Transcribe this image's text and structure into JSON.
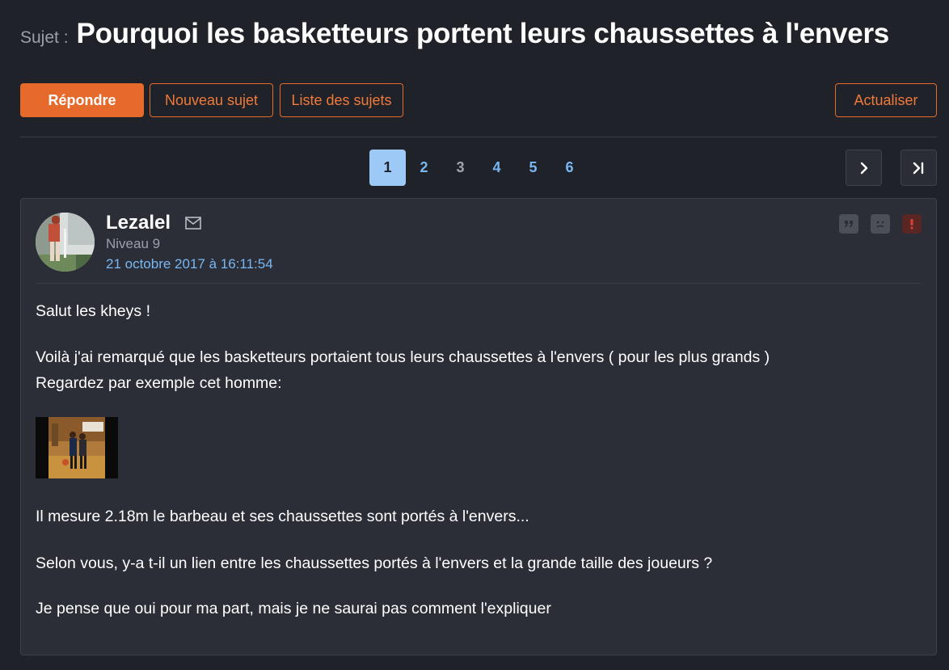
{
  "topic": {
    "prefix": "Sujet :",
    "title": "Pourquoi les basketteurs portent leurs chaussettes à l'envers"
  },
  "actions": {
    "reply": "Répondre",
    "new_topic": "Nouveau sujet",
    "topic_list": "Liste des sujets",
    "refresh": "Actualiser"
  },
  "pagination": {
    "pages": [
      "1",
      "2",
      "3",
      "4",
      "5",
      "6"
    ],
    "current": "1",
    "next_icon": "chevron-right-icon",
    "last_icon": "last-page-icon"
  },
  "post": {
    "author": "Lezalel",
    "level": "Niveau 9",
    "date": "21 octobre 2017 à 16:11:54",
    "paragraphs": [
      "Salut les kheys !",
      "Voilà j'ai remarqué que les basketteurs portaient tous leurs chaussettes à l'envers ( pour les plus grands )",
      "Regardez par exemple cet homme:",
      "Il mesure 2.18m le barbeau et ses chaussettes sont portés à l'envers...",
      "Selon vous, y-a t-il un lien entre les chaussettes portés à l'envers et la grande taille des joueurs ?",
      "Je pense que oui pour ma part, mais je ne saurai pas comment l'expliquer"
    ],
    "icons": [
      "mail-icon",
      "quote-icon",
      "blacklist-icon",
      "report-icon"
    ]
  },
  "colors": {
    "background": "#202229",
    "panel": "#2b2e36",
    "accent": "#e56a2c",
    "link": "#79b7f2",
    "active_page": "#9cc9f5"
  }
}
